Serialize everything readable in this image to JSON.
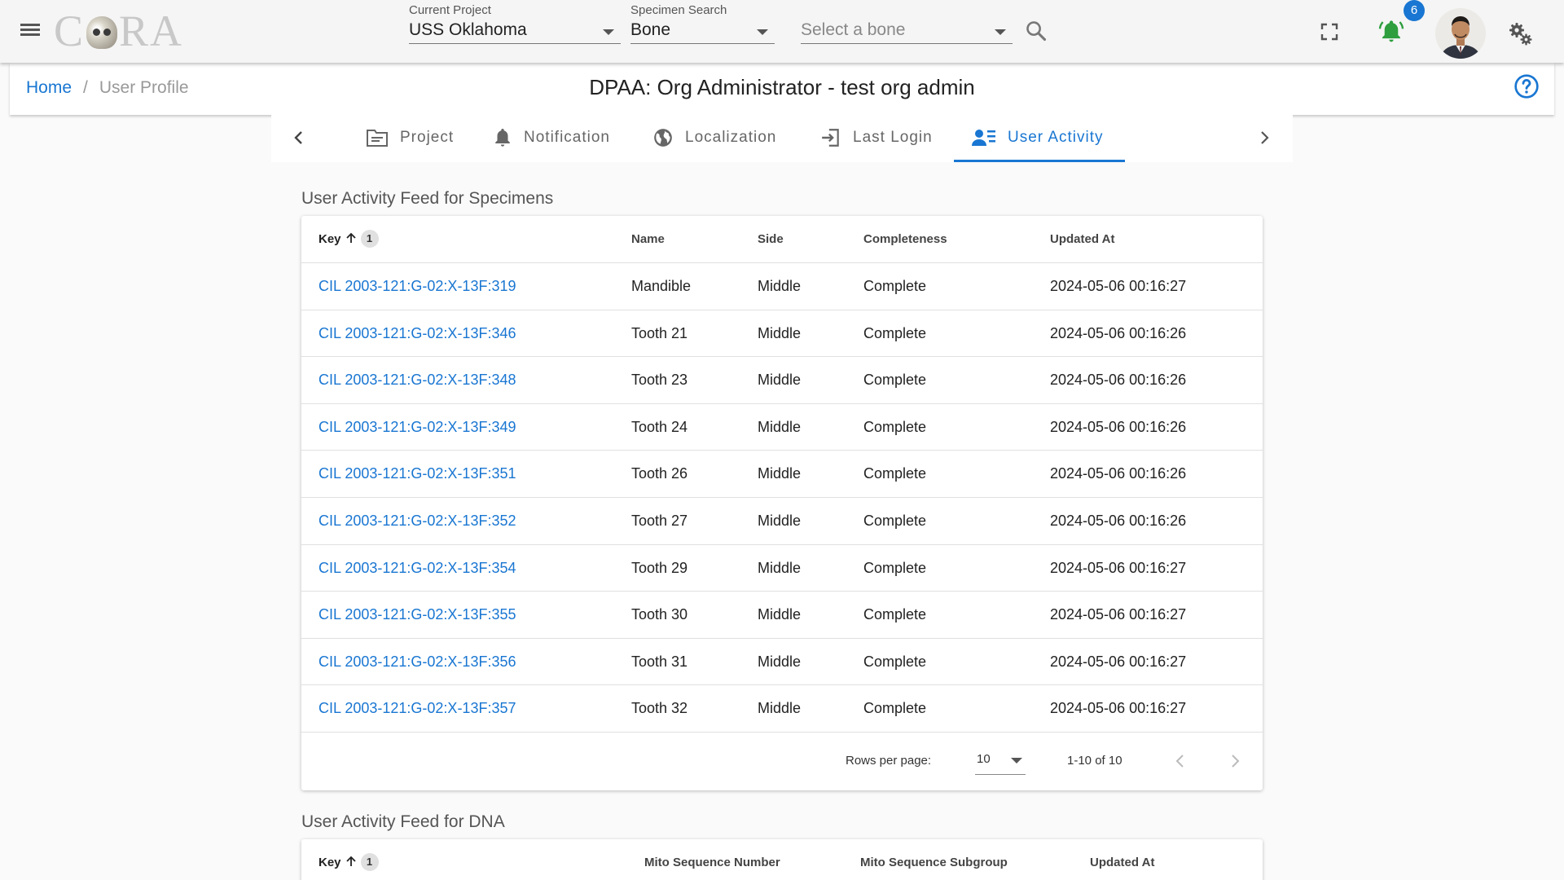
{
  "app": {
    "logo_text_left": "C",
    "logo_text_right": "RA",
    "logo_name": "CORA"
  },
  "header": {
    "current_project": {
      "label": "Current Project",
      "value": "USS Oklahoma"
    },
    "specimen_search": {
      "label": "Specimen Search",
      "value": "Bone"
    },
    "bone_select": {
      "placeholder": "Select a bone"
    },
    "notification_count": "6",
    "icons": [
      "menu-icon",
      "search-icon",
      "fullscreen-icon",
      "bell-icon",
      "settings-icon"
    ],
    "bell_color": "#2e9e3e"
  },
  "breadcrumb": {
    "home": "Home",
    "separator": "/",
    "current": "User Profile"
  },
  "page_title": "DPAA: Org Administrator - test org admin",
  "tabs": [
    {
      "label": "Project",
      "icon": "folder-icon"
    },
    {
      "label": "Notification",
      "icon": "bell-icon"
    },
    {
      "label": "Localization",
      "icon": "globe-icon"
    },
    {
      "label": "Last Login",
      "icon": "login-icon"
    },
    {
      "label": "User Activity",
      "icon": "user-activity-icon",
      "active": true
    }
  ],
  "specimens": {
    "title": "User Activity Feed for Specimens",
    "columns": [
      "Key",
      "Name",
      "Side",
      "Completeness",
      "Updated At"
    ],
    "sort_index": "1",
    "rows": [
      {
        "key": "CIL 2003-121:G-02:X-13F:319",
        "name": "Mandible",
        "side": "Middle",
        "completeness": "Complete",
        "updated": "2024-05-06 00:16:27"
      },
      {
        "key": "CIL 2003-121:G-02:X-13F:346",
        "name": "Tooth 21",
        "side": "Middle",
        "completeness": "Complete",
        "updated": "2024-05-06 00:16:26"
      },
      {
        "key": "CIL 2003-121:G-02:X-13F:348",
        "name": "Tooth 23",
        "side": "Middle",
        "completeness": "Complete",
        "updated": "2024-05-06 00:16:26"
      },
      {
        "key": "CIL 2003-121:G-02:X-13F:349",
        "name": "Tooth 24",
        "side": "Middle",
        "completeness": "Complete",
        "updated": "2024-05-06 00:16:26"
      },
      {
        "key": "CIL 2003-121:G-02:X-13F:351",
        "name": "Tooth 26",
        "side": "Middle",
        "completeness": "Complete",
        "updated": "2024-05-06 00:16:26"
      },
      {
        "key": "CIL 2003-121:G-02:X-13F:352",
        "name": "Tooth 27",
        "side": "Middle",
        "completeness": "Complete",
        "updated": "2024-05-06 00:16:26"
      },
      {
        "key": "CIL 2003-121:G-02:X-13F:354",
        "name": "Tooth 29",
        "side": "Middle",
        "completeness": "Complete",
        "updated": "2024-05-06 00:16:27"
      },
      {
        "key": "CIL 2003-121:G-02:X-13F:355",
        "name": "Tooth 30",
        "side": "Middle",
        "completeness": "Complete",
        "updated": "2024-05-06 00:16:27"
      },
      {
        "key": "CIL 2003-121:G-02:X-13F:356",
        "name": "Tooth 31",
        "side": "Middle",
        "completeness": "Complete",
        "updated": "2024-05-06 00:16:27"
      },
      {
        "key": "CIL 2003-121:G-02:X-13F:357",
        "name": "Tooth 32",
        "side": "Middle",
        "completeness": "Complete",
        "updated": "2024-05-06 00:16:27"
      }
    ],
    "footer": {
      "rows_per_page_label": "Rows per page:",
      "rows_per_page": "10",
      "range": "1-10 of 10"
    }
  },
  "dna": {
    "title": "User Activity Feed for DNA",
    "columns": [
      "Key",
      "Mito Sequence Number",
      "Mito Sequence Subgroup",
      "Updated At"
    ],
    "sort_index": "1"
  }
}
